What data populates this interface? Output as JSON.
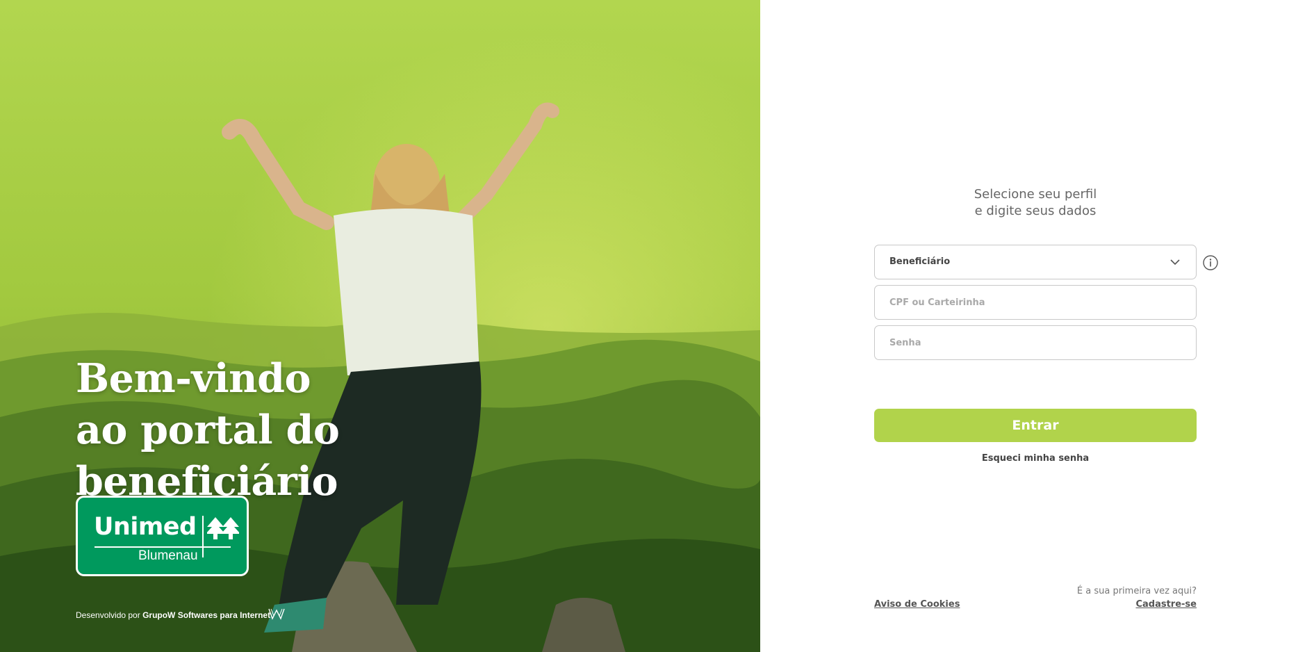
{
  "hero": {
    "title_lines": [
      "Bem-vindo",
      "ao portal do",
      "beneficiário"
    ],
    "logo": {
      "word": "Unimed",
      "city": "Blumenau",
      "color": "#00995d"
    },
    "credit": {
      "prefix": "Desenvolvido por",
      "company": "GrupoW Softwares para Internet"
    },
    "background_theme": "#a5cd45"
  },
  "login": {
    "heading": [
      "Selecione seu perfil",
      "e digite seus dados"
    ],
    "profile_select": {
      "value": "Beneficiário",
      "icon": "chevron-down-icon"
    },
    "info_icon": "info-icon",
    "cpf_field": {
      "placeholder": "CPF ou Carteirinha",
      "value": ""
    },
    "password_field": {
      "placeholder": "Senha",
      "value": ""
    },
    "submit_label": "Entrar",
    "forgot_label": "Esqueci minha senha",
    "accent_color": "#b1d34b"
  },
  "footer": {
    "cookies_label": "Aviso de Cookies",
    "first_time_text": "É a sua primeira vez aqui?",
    "signup_label": "Cadastre-se"
  }
}
